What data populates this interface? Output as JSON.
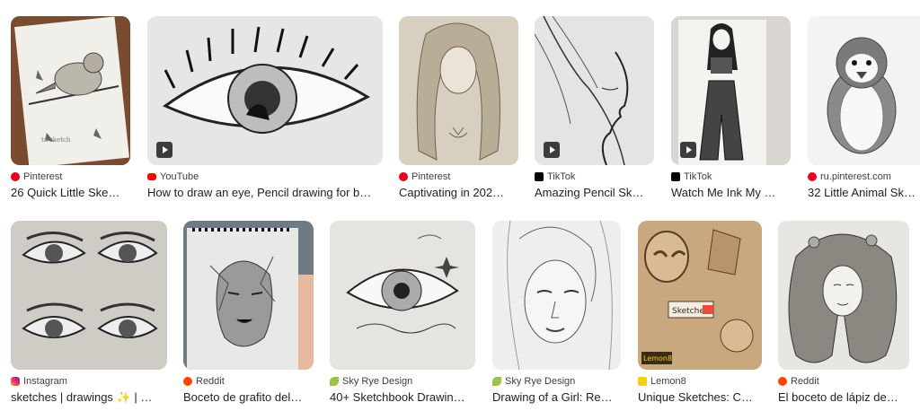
{
  "row1": [
    {
      "source": "Pinterest",
      "icon": "pinterest-icon",
      "title": "26 Quick Little Ske…"
    },
    {
      "source": "YouTube",
      "icon": "youtube-icon",
      "title": "How to draw an eye, Pencil drawing for b…"
    },
    {
      "source": "Pinterest",
      "icon": "pinterest-icon",
      "title": "Captivating in 202…"
    },
    {
      "source": "TikTok",
      "icon": "tiktok-icon",
      "title": "Amazing Pencil Sk…"
    },
    {
      "source": "TikTok",
      "icon": "tiktok-icon",
      "title": "Watch Me Ink My …"
    },
    {
      "source": "ru.pinterest.com",
      "icon": "pinterest-icon",
      "title": "32 Little Animal Sk…"
    }
  ],
  "row2": [
    {
      "source": "Instagram",
      "icon": "instagram-icon",
      "title": "sketches | drawings ✨ | …"
    },
    {
      "source": "Reddit",
      "icon": "reddit-icon",
      "title": "Boceto de grafito del…"
    },
    {
      "source": "Sky Rye Design",
      "icon": "sky-rye-icon",
      "title": "40+ Sketchbook Drawin…"
    },
    {
      "source": "Sky Rye Design",
      "icon": "sky-rye-icon",
      "title": "Drawing of a Girl: Re…"
    },
    {
      "source": "Lemon8",
      "icon": "lemon8-icon",
      "title": "Unique Sketches: C…"
    },
    {
      "source": "Reddit",
      "icon": "reddit-icon",
      "title": "El boceto de lápiz de…"
    }
  ],
  "thumb_text": {
    "sketches_label": "Sketches",
    "lemon_label": "Lemon8"
  }
}
